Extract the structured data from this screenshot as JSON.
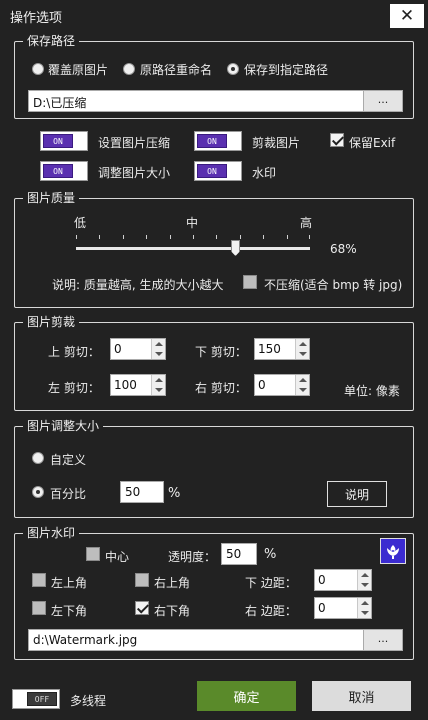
{
  "window": {
    "title": "操作选项",
    "close_glyph": "✕"
  },
  "save_path": {
    "legend": "保存路径",
    "options": [
      "覆盖原图片",
      "原路径重命名",
      "保存到指定路径"
    ],
    "selected": 2,
    "path_value": "D:\\已压缩",
    "browse_label": "..."
  },
  "switches": {
    "compress": {
      "label": "设置图片压缩",
      "state": "ON"
    },
    "crop": {
      "label": "剪裁图片",
      "state": "ON"
    },
    "resize": {
      "label": "调整图片大小",
      "state": "ON"
    },
    "watermark": {
      "label": "水印",
      "state": "ON"
    },
    "keep_exif": {
      "label": "保留Exif",
      "checked": true
    }
  },
  "quality": {
    "legend": "图片质量",
    "low": "低",
    "mid": "中",
    "high": "高",
    "value_text": "68%",
    "value": 68,
    "note": "说明: 质量越高, 生成的大小越大",
    "no_compress_label": "不压缩(适合 bmp 转 jpg)",
    "no_compress_checked": false
  },
  "crop": {
    "legend": "图片剪裁",
    "top_label": "上 剪切：",
    "top_value": "0",
    "bottom_label": "下 剪切：",
    "bottom_value": "150",
    "left_label": "左 剪切：",
    "left_value": "100",
    "right_label": "右 剪切：",
    "right_value": "0",
    "unit": "单位: 像素"
  },
  "resize": {
    "legend": "图片调整大小",
    "custom_label": "自定义",
    "percent_label": "百分比",
    "percent_value": "50",
    "percent_sign": "%",
    "help_label": "说明",
    "selected": "percent"
  },
  "watermark": {
    "legend": "图片水印",
    "center_label": "中心",
    "opacity_label": "透明度：",
    "opacity_value": "50",
    "opacity_sign": "%",
    "top_left": "左上角",
    "top_right": "右上角",
    "bottom_left": "左下角",
    "bottom_right": "右下角",
    "bottom_right_checked": true,
    "margin_bottom_label": "下 边距：",
    "margin_bottom_value": "0",
    "margin_right_label": "右 边距：",
    "margin_right_value": "0",
    "file_value": "d:\\Watermark.jpg",
    "browse_label": "...",
    "icon_color": "#3b2bd0"
  },
  "footer": {
    "multithread_label": "多线程",
    "multithread_state": "OFF",
    "ok_label": "确定",
    "cancel_label": "取消",
    "ok_color": "#5a8a2a"
  }
}
